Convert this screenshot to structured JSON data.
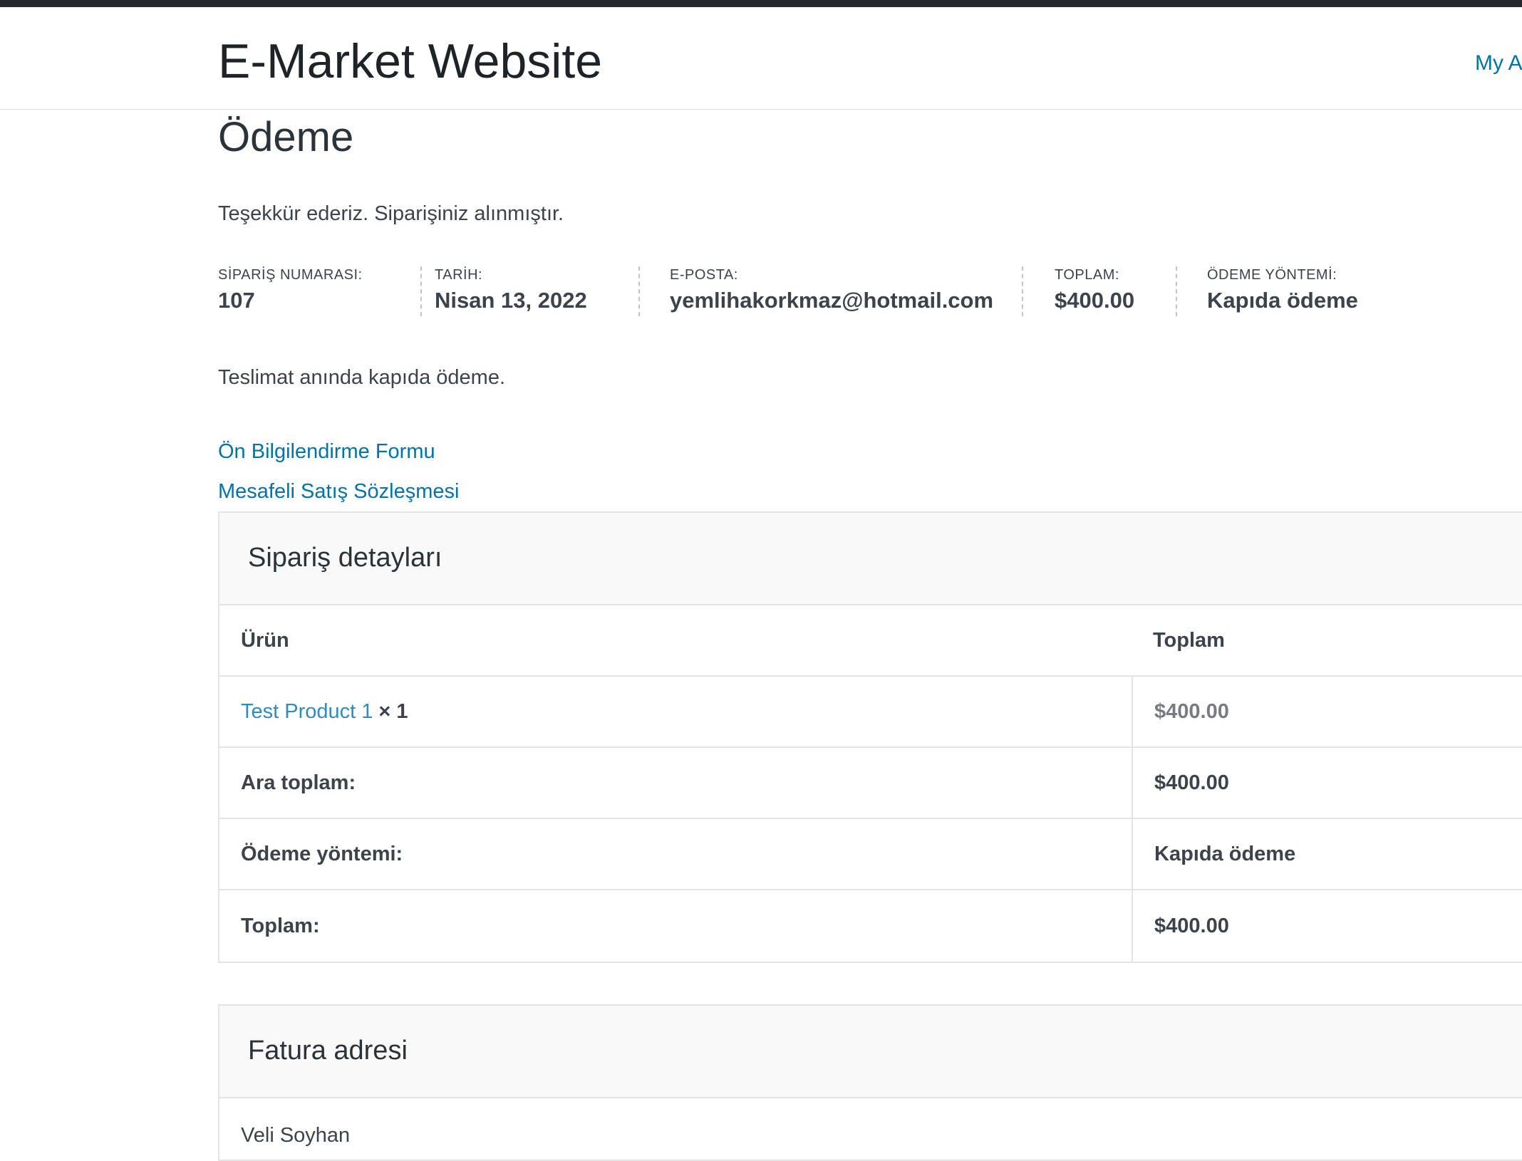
{
  "header": {
    "site_title": "E-Market Website",
    "account_link": "My A"
  },
  "page": {
    "title": "Ödeme",
    "thank_you": "Teşekkür ederiz. Siparişiniz alınmıştır."
  },
  "overview": {
    "order_number_label": "SİPARİŞ NUMARASI:",
    "order_number": "107",
    "date_label": "TARİH:",
    "date": "Nisan 13, 2022",
    "email_label": "E-POSTA:",
    "email": "yemlihakorkmaz@hotmail.com",
    "total_label": "TOPLAM:",
    "total": "$400.00",
    "payment_method_label": "ÖDEME YÖNTEMİ:",
    "payment_method": "Kapıda ödeme"
  },
  "payment_note": "Teslimat anında kapıda ödeme.",
  "links": {
    "pre_info_form": "Ön Bilgilendirme Formu",
    "distance_sales": "Mesafeli Satış Sözleşmesi"
  },
  "order_details": {
    "heading": "Sipariş detayları",
    "col_product": "Ürün",
    "col_total": "Toplam",
    "item": {
      "name": "Test Product 1",
      "qty": "× 1",
      "total": "$400.00"
    },
    "subtotal_label": "Ara toplam:",
    "subtotal": "$400.00",
    "payment_label": "Ödeme yöntemi:",
    "payment": "Kapıda ödeme",
    "total_label": "Toplam:",
    "total": "$400.00"
  },
  "billing": {
    "heading": "Fatura adresi",
    "name": "Veli Soyhan"
  }
}
